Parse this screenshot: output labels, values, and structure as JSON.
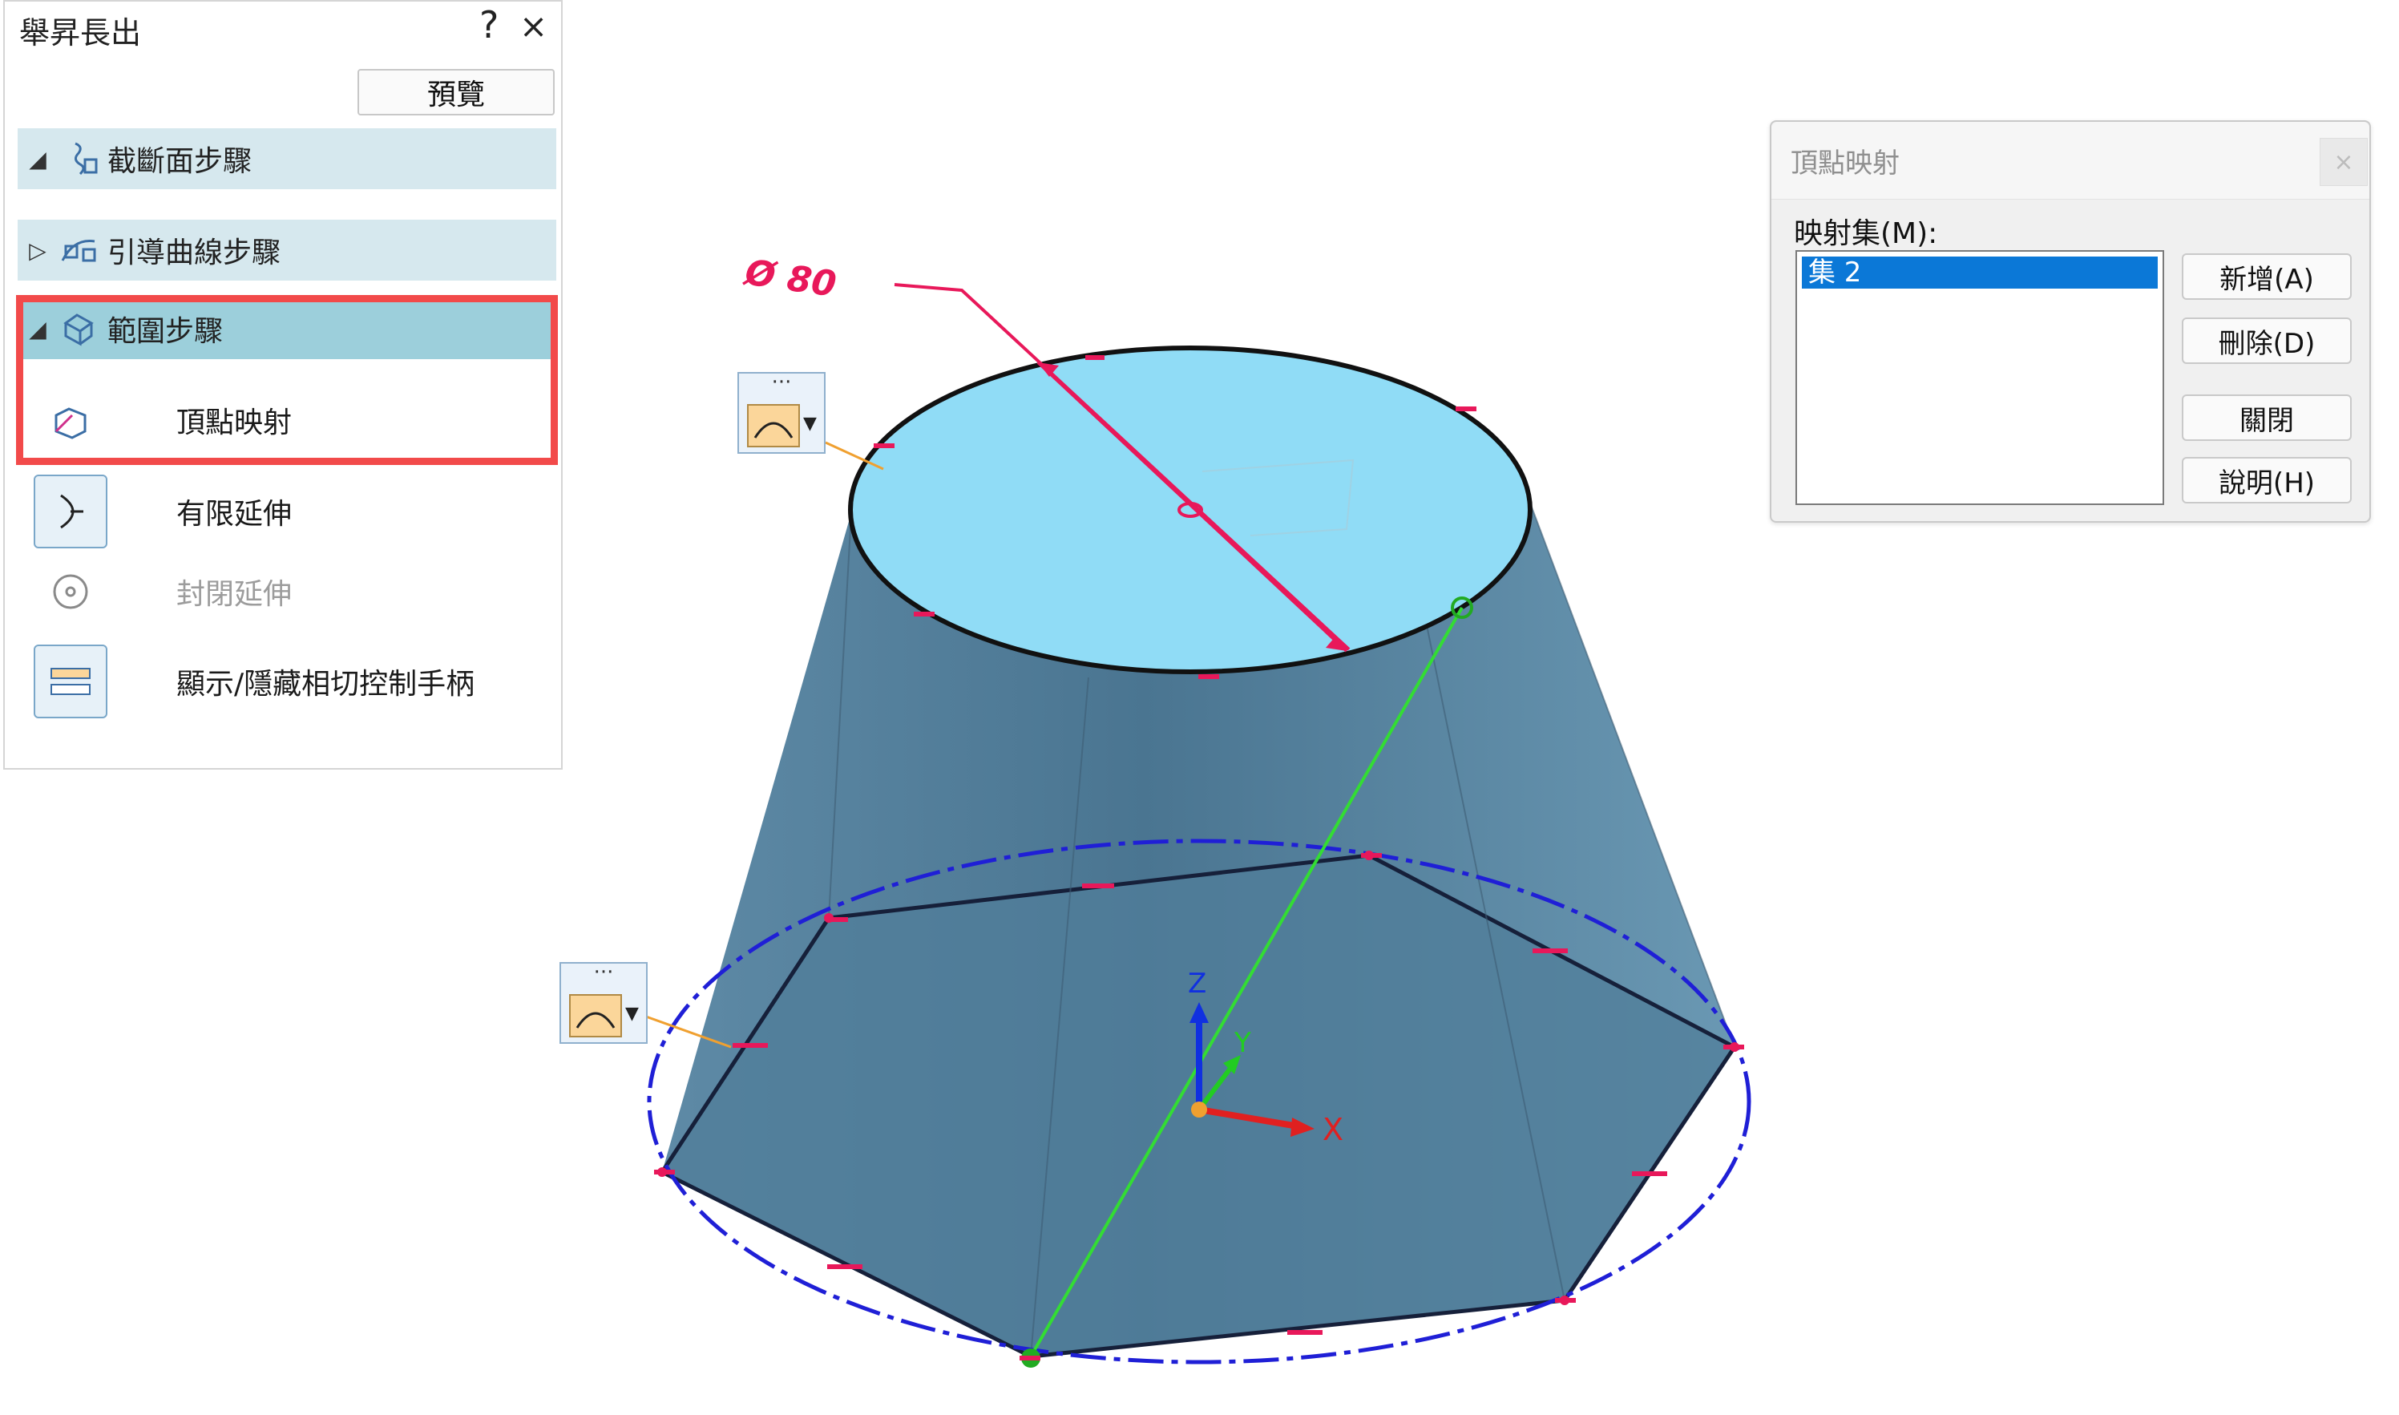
{
  "panel": {
    "title": "舉昇長出",
    "help_symbol": "?",
    "close_symbol": "×",
    "preview_label": "預覽",
    "steps": [
      {
        "label": "截斷面步驟",
        "expanded": true
      },
      {
        "label": "引導曲線步驟",
        "expanded": false
      },
      {
        "label": "範圍步驟",
        "expanded": true,
        "active": true
      }
    ],
    "commands": [
      {
        "label": "頂點映射",
        "icon": "vertex-map-icon",
        "enabled": true
      },
      {
        "label": "有限延伸",
        "icon": "finite-extent-icon",
        "enabled": true
      },
      {
        "label": "封閉延伸",
        "icon": "closed-extent-icon",
        "enabled": false
      },
      {
        "label": "顯示/隱藏相切控制手柄",
        "icon": "tangent-handle-icon",
        "enabled": true
      }
    ]
  },
  "dialog": {
    "title": "頂點映射",
    "close_symbol": "×",
    "map_set_label": "映射集(M):",
    "map_sets": [
      "集 2"
    ],
    "buttons": {
      "add": "新增(A)",
      "delete": "刪除(D)",
      "close": "關閉",
      "help": "說明(H)"
    }
  },
  "viewport": {
    "dimension_label": "Ø 80",
    "axes": {
      "x": "X",
      "y": "Y",
      "z": "Z"
    },
    "widget_dots": "···",
    "colors": {
      "body_fill": "#4d7894",
      "top_face": "#90dcf6",
      "dimension": "#e8185a",
      "circle_dash": "#1f1fd6",
      "map_line": "#33dd33"
    }
  }
}
